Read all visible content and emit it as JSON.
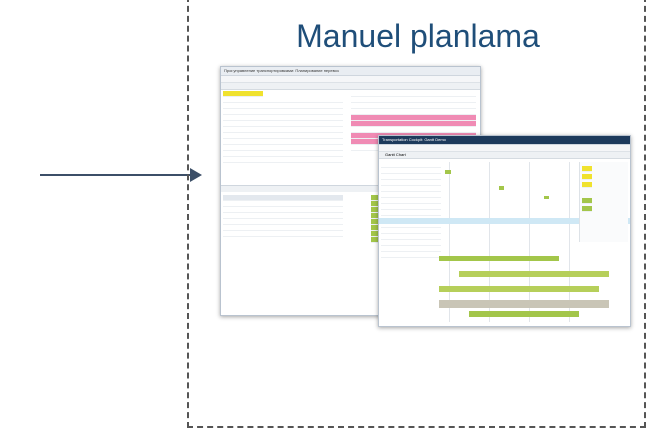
{
  "title": "Manuel planlama",
  "screenshots": {
    "left_window_title": "Прог.управление транспортировками: Планирование перевоз",
    "right_window_title": "Transportation Cockpit: Gantt Demo",
    "right_gantt_label": "Gantt Chart"
  },
  "colors": {
    "title": "#1f4e79",
    "arrow": "#3c4f68",
    "frame": "#555555"
  }
}
